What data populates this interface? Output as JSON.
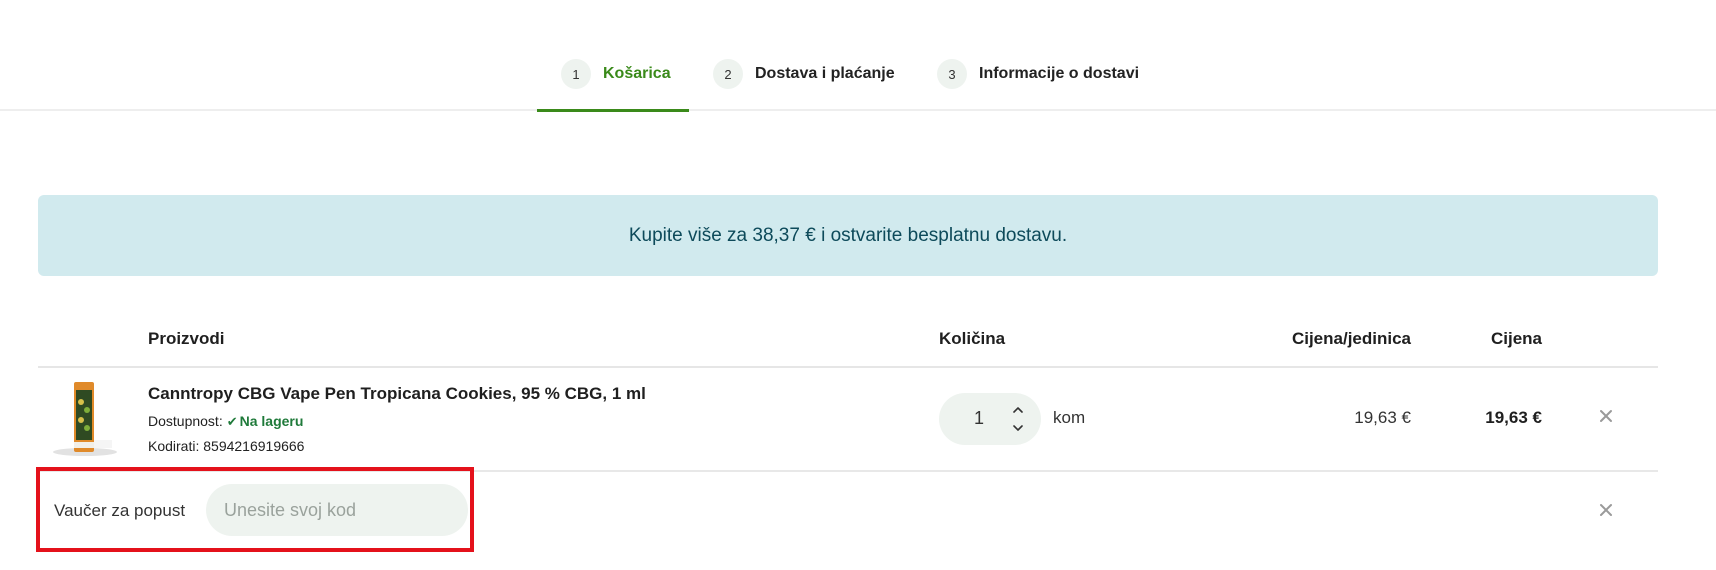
{
  "steps": [
    {
      "num": "1",
      "label": "Košarica",
      "active": true
    },
    {
      "num": "2",
      "label": "Dostava i plaćanje",
      "active": false
    },
    {
      "num": "3",
      "label": "Informacije o dostavi",
      "active": false
    }
  ],
  "banner": {
    "text": "Kupite više za 38,37 € i ostvarite besplatnu dostavu."
  },
  "table": {
    "headers": {
      "products": "Proizvodi",
      "quantity": "Količina",
      "unit_price": "Cijena/jedinica",
      "price": "Cijena"
    }
  },
  "product": {
    "name": "Canntropy CBG Vape Pen Tropicana Cookies, 95 % CBG, 1 ml",
    "availability_label": "Dostupnost:",
    "availability_value": "Na lageru",
    "sku_label": "Kodirati:",
    "sku": "8594216919666",
    "quantity": "1",
    "unit": "kom",
    "unit_price": "19,63 €",
    "total_price": "19,63 €"
  },
  "voucher": {
    "label": "Vaučer za popust",
    "placeholder": "Unesite svoj kod"
  },
  "colors": {
    "accent": "#3a8a1a",
    "banner_bg": "#d1eaee",
    "stock": "#1f7a3a",
    "highlight_border": "#e4111b"
  },
  "icons": {
    "check": "check-icon",
    "qty_up": "chevron-up-icon",
    "qty_down": "chevron-down-icon",
    "remove": "close-icon"
  }
}
